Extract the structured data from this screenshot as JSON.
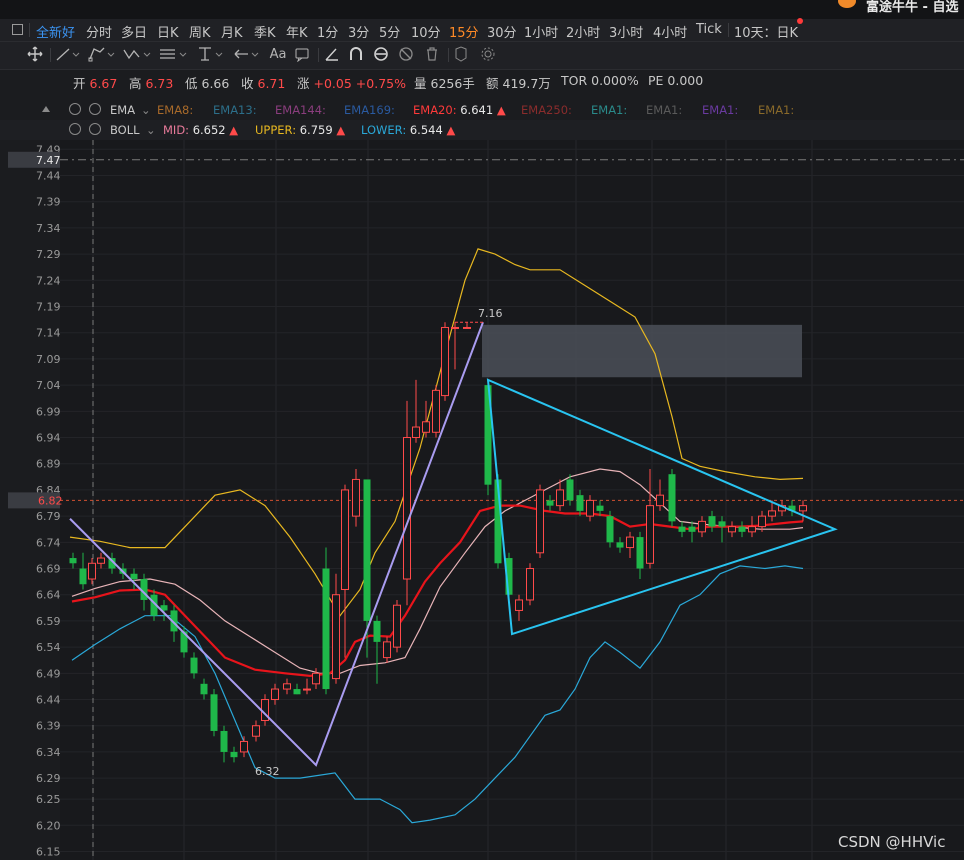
{
  "window": {
    "title": "富途牛牛 - 自选"
  },
  "timeframes": [
    "全新好",
    "分时",
    "多日",
    "日K",
    "周K",
    "月K",
    "季K",
    "年K",
    "1分",
    "3分",
    "5分",
    "10分",
    "15分",
    "30分",
    "1小时",
    "2小时",
    "3小时",
    "4小时",
    "Tick",
    "10天：日K"
  ],
  "timeframe_active": "15分",
  "quote": {
    "open_label": "开",
    "open": "6.67",
    "high_label": "高",
    "high": "6.73",
    "low_label": "低",
    "low": "6.66",
    "close_label": "收",
    "close": "6.71",
    "chg_label": "涨",
    "chg": "+0.05",
    "chg_pct": "+0.75%",
    "vol_label": "量",
    "vol": "6256手",
    "amt_label": "额",
    "amt": "419.7万",
    "tor": "TOR 0.000%",
    "pe": "PE 0.000"
  },
  "ema_row": {
    "name": "EMA",
    "items": [
      {
        "label": "EMA8:",
        "color": "#a86a2a"
      },
      {
        "label": "EMA13:",
        "color": "#2c6f8a"
      },
      {
        "label": "EMA144:",
        "color": "#8a3d7d"
      },
      {
        "label": "EMA169:",
        "color": "#2a5aa0"
      },
      {
        "label": "EMA20:",
        "value": "6.641",
        "color": "#ff3a3a"
      },
      {
        "label": "EMA250:",
        "color": "#8a2c2c"
      },
      {
        "label": "EMA1:",
        "color": "#2a8a8a"
      },
      {
        "label": "EMA1:",
        "color": "#5a5a5a"
      },
      {
        "label": "EMA1:",
        "color": "#6a3aa0"
      },
      {
        "label": "EMA1:",
        "color": "#8a6a2a"
      }
    ]
  },
  "boll_row": {
    "name": "BOLL",
    "mid_label": "MID:",
    "mid": "6.652",
    "upper_label": "UPPER:",
    "upper": "6.759",
    "lower_label": "LOWER:",
    "lower": "6.544"
  },
  "colors": {
    "up": "#ff4a4a",
    "down": "#1fb84a",
    "mid": "#e8141b",
    "upper": "#e8b820",
    "lower": "#2aa8d8",
    "pink": "#e8b4b8",
    "triangle": "#29c4f0",
    "purple_line": "#a99cf0"
  },
  "price_axis": {
    "ticks": [
      "7.49",
      "7.44",
      "7.39",
      "7.34",
      "7.29",
      "7.24",
      "7.19",
      "7.14",
      "7.09",
      "7.04",
      "6.99",
      "6.94",
      "6.89",
      "6.84",
      "6.79",
      "6.74",
      "6.69",
      "6.64",
      "6.59",
      "6.54",
      "6.49",
      "6.44",
      "6.39",
      "6.34",
      "6.29",
      "6.25",
      "6.20",
      "6.15"
    ],
    "crosshair_price": "7.47",
    "last_price": "6.82"
  },
  "chart_labels": {
    "high_mark": "7.16",
    "low_mark": "6.32"
  },
  "watermark": "CSDN @HHVic"
}
